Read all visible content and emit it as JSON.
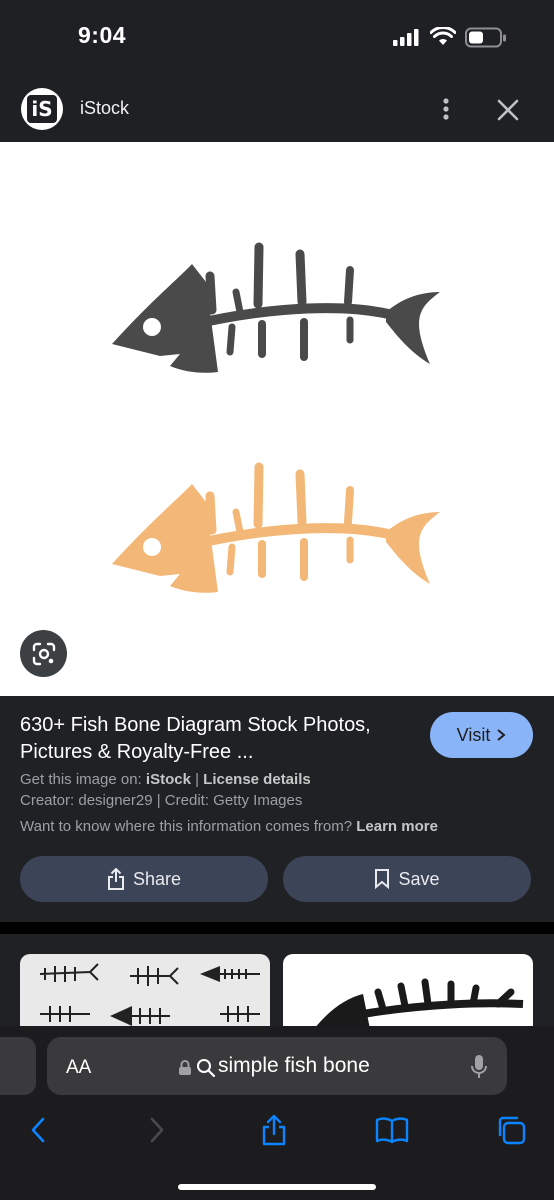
{
  "status_bar": {
    "time": "9:04"
  },
  "header": {
    "logo_text": "iS",
    "site_name": "iStock"
  },
  "result": {
    "title": "630+ Fish Bone Diagram Stock Photos, Pictures & Royalty-Free ...",
    "visit_label": "Visit",
    "source_prefix": "Get this image on: ",
    "source_name": "iStock",
    "license_label": "License details",
    "credit_line": "Creator: designer29 | Credit: Getty Images",
    "info_question": "Want to know where this information comes from? ",
    "learn_more": "Learn more",
    "share_label": "Share",
    "save_label": "Save"
  },
  "safari": {
    "aa_label": "AA",
    "url_text": "simple fish bone"
  },
  "colors": {
    "fish_dark": "#4a4a4a",
    "fish_orange": "#f3b877",
    "accent_blue": "#8ab4f8",
    "ios_blue": "#0a84ff"
  }
}
